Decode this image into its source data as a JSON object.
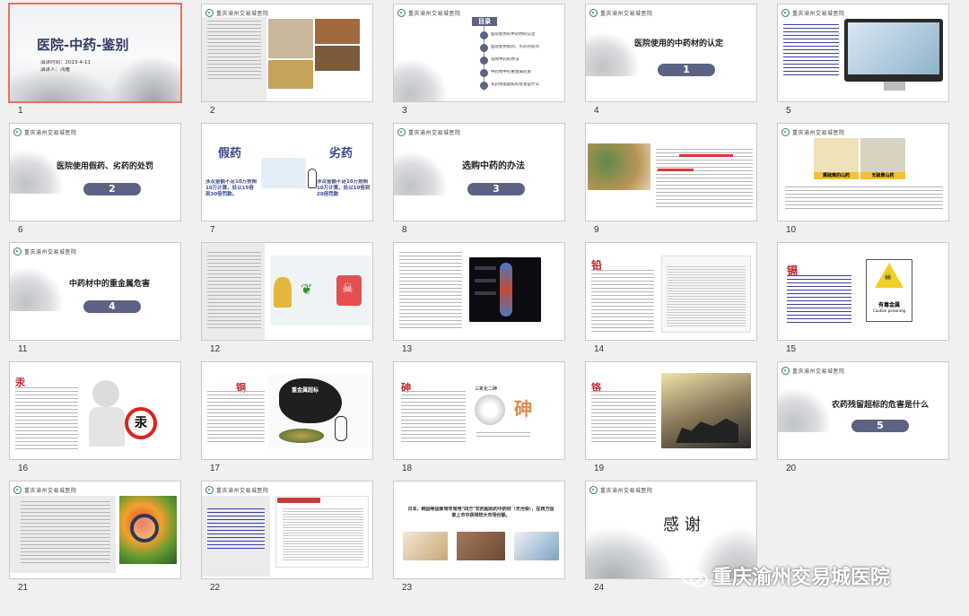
{
  "header_text": "重庆渝州交易城医院",
  "selected_slide": 1,
  "slides": [
    {
      "num": "1",
      "title": "医院-中药-鉴别",
      "sub1": "演讲时间：2023-4-11",
      "sub2": "演讲人：鸿雁"
    },
    {
      "num": "2"
    },
    {
      "num": "3",
      "title": "目录",
      "items": [
        "医院使用的中药材的认定",
        "医院使用假药、劣药的处罚",
        "选购中药的办法",
        "中药材中的重金属危害",
        "农药残留超标的危害是什么"
      ]
    },
    {
      "num": "4",
      "title": "医院使用的中药材的认定",
      "pill": "1"
    },
    {
      "num": "5"
    },
    {
      "num": "6",
      "title": "医院使用假药、劣药的处罚",
      "pill": "2"
    },
    {
      "num": "7",
      "left_title": "假药",
      "right_title": "劣药",
      "left_text": "涉及金额不足10万按照10万计算，处以15倍到30倍罚款。",
      "right_text": "涉及金额不足10万按照10万计算，处以10倍到20倍罚款"
    },
    {
      "num": "8",
      "title": "选购中药的办法",
      "pill": "3"
    },
    {
      "num": "9"
    },
    {
      "num": "10",
      "caption_left": "熏硫黄的山药",
      "caption_right": "无硫黄山药"
    },
    {
      "num": "11",
      "title": "中药材中的重金属危害",
      "pill": "4"
    },
    {
      "num": "12"
    },
    {
      "num": "13"
    },
    {
      "num": "14",
      "tag": "铅"
    },
    {
      "num": "15",
      "tag": "镉",
      "sign_title": "有毒金属",
      "sign_sub": "Caution poisoning"
    },
    {
      "num": "16",
      "tag": "汞",
      "badge": "汞"
    },
    {
      "num": "17",
      "tag": "铜",
      "banner": "重金属超标"
    },
    {
      "num": "18",
      "tag": "砷",
      "big_char": "砷",
      "label": "三氧化二砷"
    },
    {
      "num": "19",
      "tag": "铬"
    },
    {
      "num": "20",
      "title": "农药残留超标的危害是什么",
      "pill": "5"
    },
    {
      "num": "21"
    },
    {
      "num": "22"
    },
    {
      "num": "23",
      "text": "日本、韩国等国家常年常用\"四方\"农药超标的中药材（无污染），在西方国家上市中获得较大市场份额。"
    },
    {
      "num": "24",
      "title": "感  谢"
    }
  ],
  "watermark": "重庆渝州交易城医院",
  "colors": {
    "accent": "#5b6283",
    "selected_border": "#e8715b",
    "logo_green": "#2f8a3e",
    "red": "#c0282d"
  }
}
